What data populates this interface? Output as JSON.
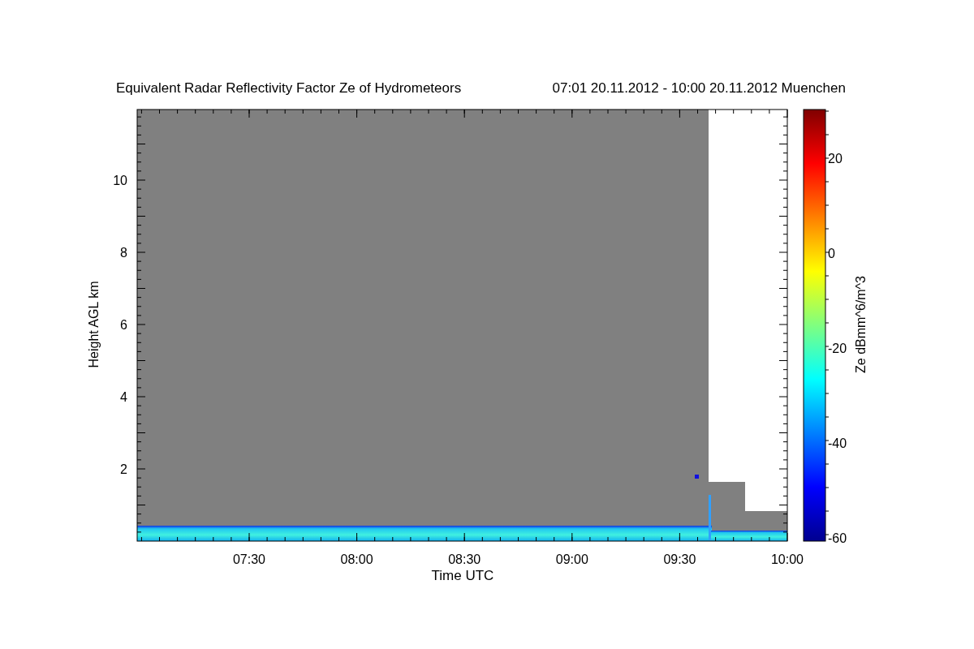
{
  "title": "Equivalent Radar Reflectivity Factor Ze of Hydrometeors",
  "period": "07:01 20.11.2012 - 10:00 20.11.2012 Muenchen",
  "x_axis": {
    "label": "Time UTC",
    "ticks": [
      "07:30",
      "08:00",
      "08:30",
      "09:00",
      "09:30",
      "10:00"
    ]
  },
  "y_axis": {
    "label": "Height AGL km",
    "ticks": [
      "10",
      "8",
      "6",
      "4",
      "2"
    ]
  },
  "colorbar": {
    "label": "Ze dBmm^6/m^3",
    "ticks": [
      "20",
      "0",
      "-20",
      "-40",
      "-60"
    ]
  }
}
